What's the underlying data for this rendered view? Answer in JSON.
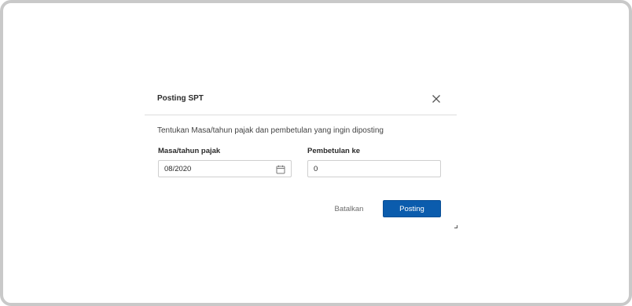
{
  "dialog": {
    "title": "Posting SPT",
    "instruction": "Tentukan Masa/tahun pajak dan pembetulan yang ingin diposting",
    "close_icon": "close-icon"
  },
  "form": {
    "masa_label": "Masa/tahun pajak",
    "masa_value": "08/2020",
    "masa_icon": "calendar-icon",
    "pembetulan_label": "Pembetulan ke",
    "pembetulan_value": "0"
  },
  "actions": {
    "cancel_label": "Batalkan",
    "submit_label": "Posting"
  },
  "colors": {
    "primary": "#0b5cad",
    "frame_border": "#c9c9c9"
  }
}
